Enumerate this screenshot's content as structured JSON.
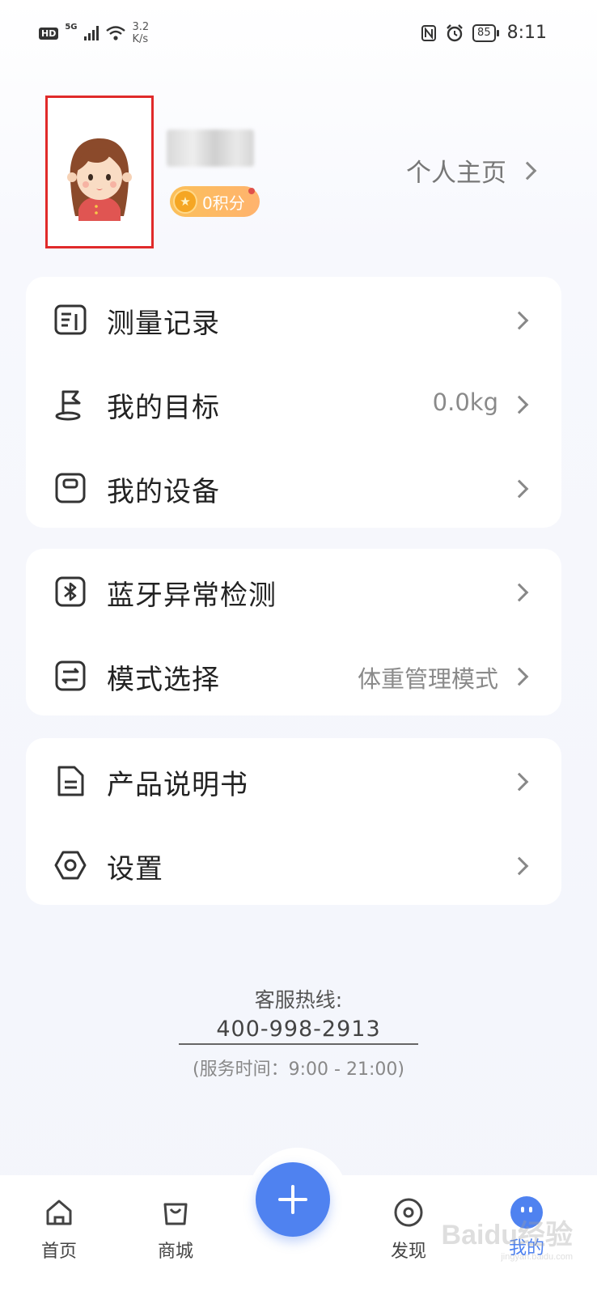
{
  "status_bar": {
    "hd": "HD",
    "network": "5G",
    "speed_value": "3.2",
    "speed_unit": "K/s",
    "battery": "85",
    "time": "8:11"
  },
  "profile": {
    "points": "0积分",
    "homepage_link": "个人主页"
  },
  "menu_groups": [
    [
      {
        "label": "测量记录",
        "value": "",
        "icon": "record-icon"
      },
      {
        "label": "我的目标",
        "value": "0.0kg",
        "icon": "flag-icon"
      },
      {
        "label": "我的设备",
        "value": "",
        "icon": "scale-device-icon"
      }
    ],
    [
      {
        "label": "蓝牙异常检测",
        "value": "",
        "icon": "bluetooth-icon"
      },
      {
        "label": "模式选择",
        "value": "体重管理模式",
        "icon": "mode-switch-icon"
      }
    ],
    [
      {
        "label": "产品说明书",
        "value": "",
        "icon": "document-icon"
      },
      {
        "label": "设置",
        "value": "",
        "icon": "settings-icon"
      }
    ]
  ],
  "hotline": {
    "label": "客服热线:",
    "number": "400-998-2913",
    "hours": "(服务时间：9:00 - 21:00)"
  },
  "bottom_nav": {
    "home": "首页",
    "mall": "商城",
    "discover": "发现",
    "me": "我的"
  },
  "watermark": {
    "text": "Baidu经验",
    "sub": "jingyan.baidu.com"
  },
  "colors": {
    "accent": "#4f82f0",
    "points_badge": "#fbc05a",
    "highlight_frame": "#e02a2a"
  }
}
